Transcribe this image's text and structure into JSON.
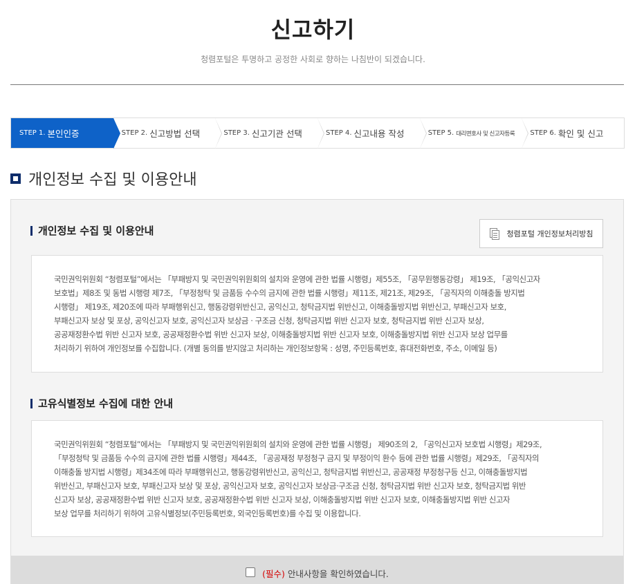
{
  "header": {
    "title": "신고하기",
    "subtitle": "청렴포털은 투명하고 공정한 사회로 향하는 나침반이 되겠습니다."
  },
  "steps": [
    {
      "no": "STEP 1.",
      "name": "본인인증",
      "active": true
    },
    {
      "no": "STEP 2.",
      "name": "신고방법 선택",
      "active": false
    },
    {
      "no": "STEP 3.",
      "name": "신고기관 선택",
      "active": false
    },
    {
      "no": "STEP 4.",
      "name": "신고내용 작성",
      "active": false
    },
    {
      "no": "STEP 5.",
      "name": "대리변호사 및 신고자등록",
      "active": false
    },
    {
      "no": "STEP 6.",
      "name": "확인 및 신고",
      "active": false
    }
  ],
  "section": {
    "title": "개인정보 수집 및 이용안내"
  },
  "privacy": {
    "title": "개인정보 수집 및 이용안내",
    "policy_button": "청렴포털 개인정보처리방침",
    "lines": [
      "국민권익위원회 “청렴포털”에서는 「부패방지 및 국민권익위원회의 설치와 운영에 관한 법률 시행령」제55조, 「공무원행동강령」 제19조, 「공익신고자",
      "보호법」제8조 및 동법 시행령 제7조, 「부정청탁 및 금품등 수수의 금지에 관한 법률 시행령」제11조, 제21조, 제29조, 「공직자의 이해충돌 방지법",
      "시행령」 제19조, 제20조에 따라 부패행위신고, 행동강령위반신고, 공익신고, 청탁금지법 위반신고, 이해충돌방지법 위반신고, 부패신고자 보호,",
      "부패신고자 보상 및 포상, 공익신고자 보호, 공익신고자 보상금 · 구조금 신청, 청탁금지법 위반 신고자 보호, 청탁금지법 위반 신고자 보상,",
      "공공재정환수법 위반 신고자 보호, 공공재정환수법 위반 신고자 보상, 이해충돌방지법 위반 신고자 보호, 이해충돌방지법 위반 신고자 보상 업무를",
      "처리하기 위하여 개인정보를 수집합니다. (개별 동의를 받지않고 처리하는 개인정보항목 : 성명, 주민등록번호, 휴대전화번호, 주소, 이메일 등)"
    ]
  },
  "unique_id": {
    "title": "고유식별정보 수집에 대한 안내",
    "lines": [
      "국민권익위원회 “청렴포털”에서는 「부패방지 및 국민권익위원회의 설치와 운영에 관한 법률 시행령」 제90조의 2, 「공익신고자 보호법 시행령」제29조,",
      "「부정청탁 및 금품등 수수의 금지에 관한 법률 시행령」제44조, 「공공재정 부정청구 금지 및 부정이익 환수 등에 관한 법률 시행령」제29조, 「공직자의",
      "이해충돌 방지법 시행령」제34조에 따라 부패행위신고, 행동강령위반신고, 공익신고, 청탁금지법 위반신고, 공공재정 부정청구등 신고, 이해충돌방지법",
      "위반신고, 부패신고자 보호, 부패신고자 보상 및 포상, 공익신고자 보호, 공익신고자 보상금·구조금 신청, 청탁금지법 위반 신고자 보호, 청탁금지법 위반",
      "신고자 보상, 공공재정환수법 위반 신고자 보호, 공공재정환수법 위반 신고자 보상, 이해충돌방지법 위반 신고자 보호, 이해충돌방지법 위반 신고자",
      "보상 업무를 처리하기 위하여 고유식별정보(주민등록번호, 외국인등록번호)를 수집 및 이용합니다."
    ]
  },
  "agree": {
    "required": "(필수)",
    "label": "안내사항을 확인하였습니다."
  }
}
